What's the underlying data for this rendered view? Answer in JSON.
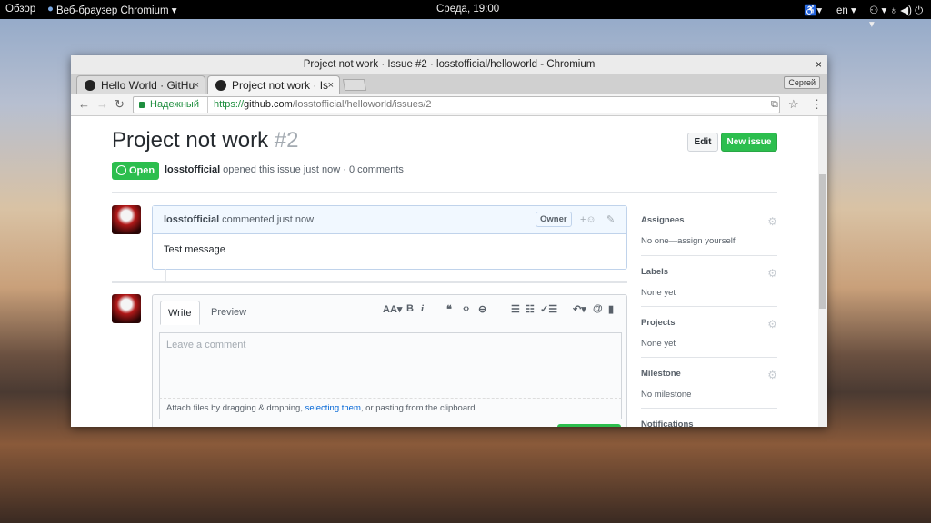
{
  "topbar": {
    "overview": "Обзор",
    "app": "Веб-браузер Chromium ▾",
    "clock": "Среда, 19:00",
    "lang": "en ▾",
    "tray": "⚇ ▾   ♁ ◀) ⏻ ▾"
  },
  "window": {
    "title": "Project not work · Issue #2 · losstofficial/helloworld - Chromium",
    "close": "×"
  },
  "tabs": [
    {
      "label": "Hello World · GitHu",
      "close": "×"
    },
    {
      "label": "Project not work · Is",
      "close": "×"
    }
  ],
  "user_button": "Сергей",
  "address": {
    "secure": "Надежный",
    "url_scheme": "https://",
    "url_host": "github.com",
    "url_path": "/losstofficial/helloworld/issues/2"
  },
  "issue": {
    "title": "Project not work",
    "number": "#2",
    "status": "Open",
    "author": "losstofficial",
    "meta": " opened this issue just now · 0 comments",
    "edit": "Edit",
    "new_issue": "New issue"
  },
  "comment": {
    "author": "losstofficial",
    "action": " commented just now",
    "badge": "Owner",
    "body": "Test message"
  },
  "editor": {
    "tab_write": "Write",
    "tab_preview": "Preview",
    "placeholder": "Leave a comment",
    "attach_pre": "Attach files by dragging & dropping, ",
    "attach_link": "selecting them",
    "attach_post": ", or pasting from the clipboard."
  },
  "sidebar": [
    {
      "title": "Assignees",
      "value": "No one—assign yourself"
    },
    {
      "title": "Labels",
      "value": "None yet"
    },
    {
      "title": "Projects",
      "value": "None yet"
    },
    {
      "title": "Milestone",
      "value": "No milestone"
    },
    {
      "title": "Notifications",
      "value": ""
    }
  ]
}
